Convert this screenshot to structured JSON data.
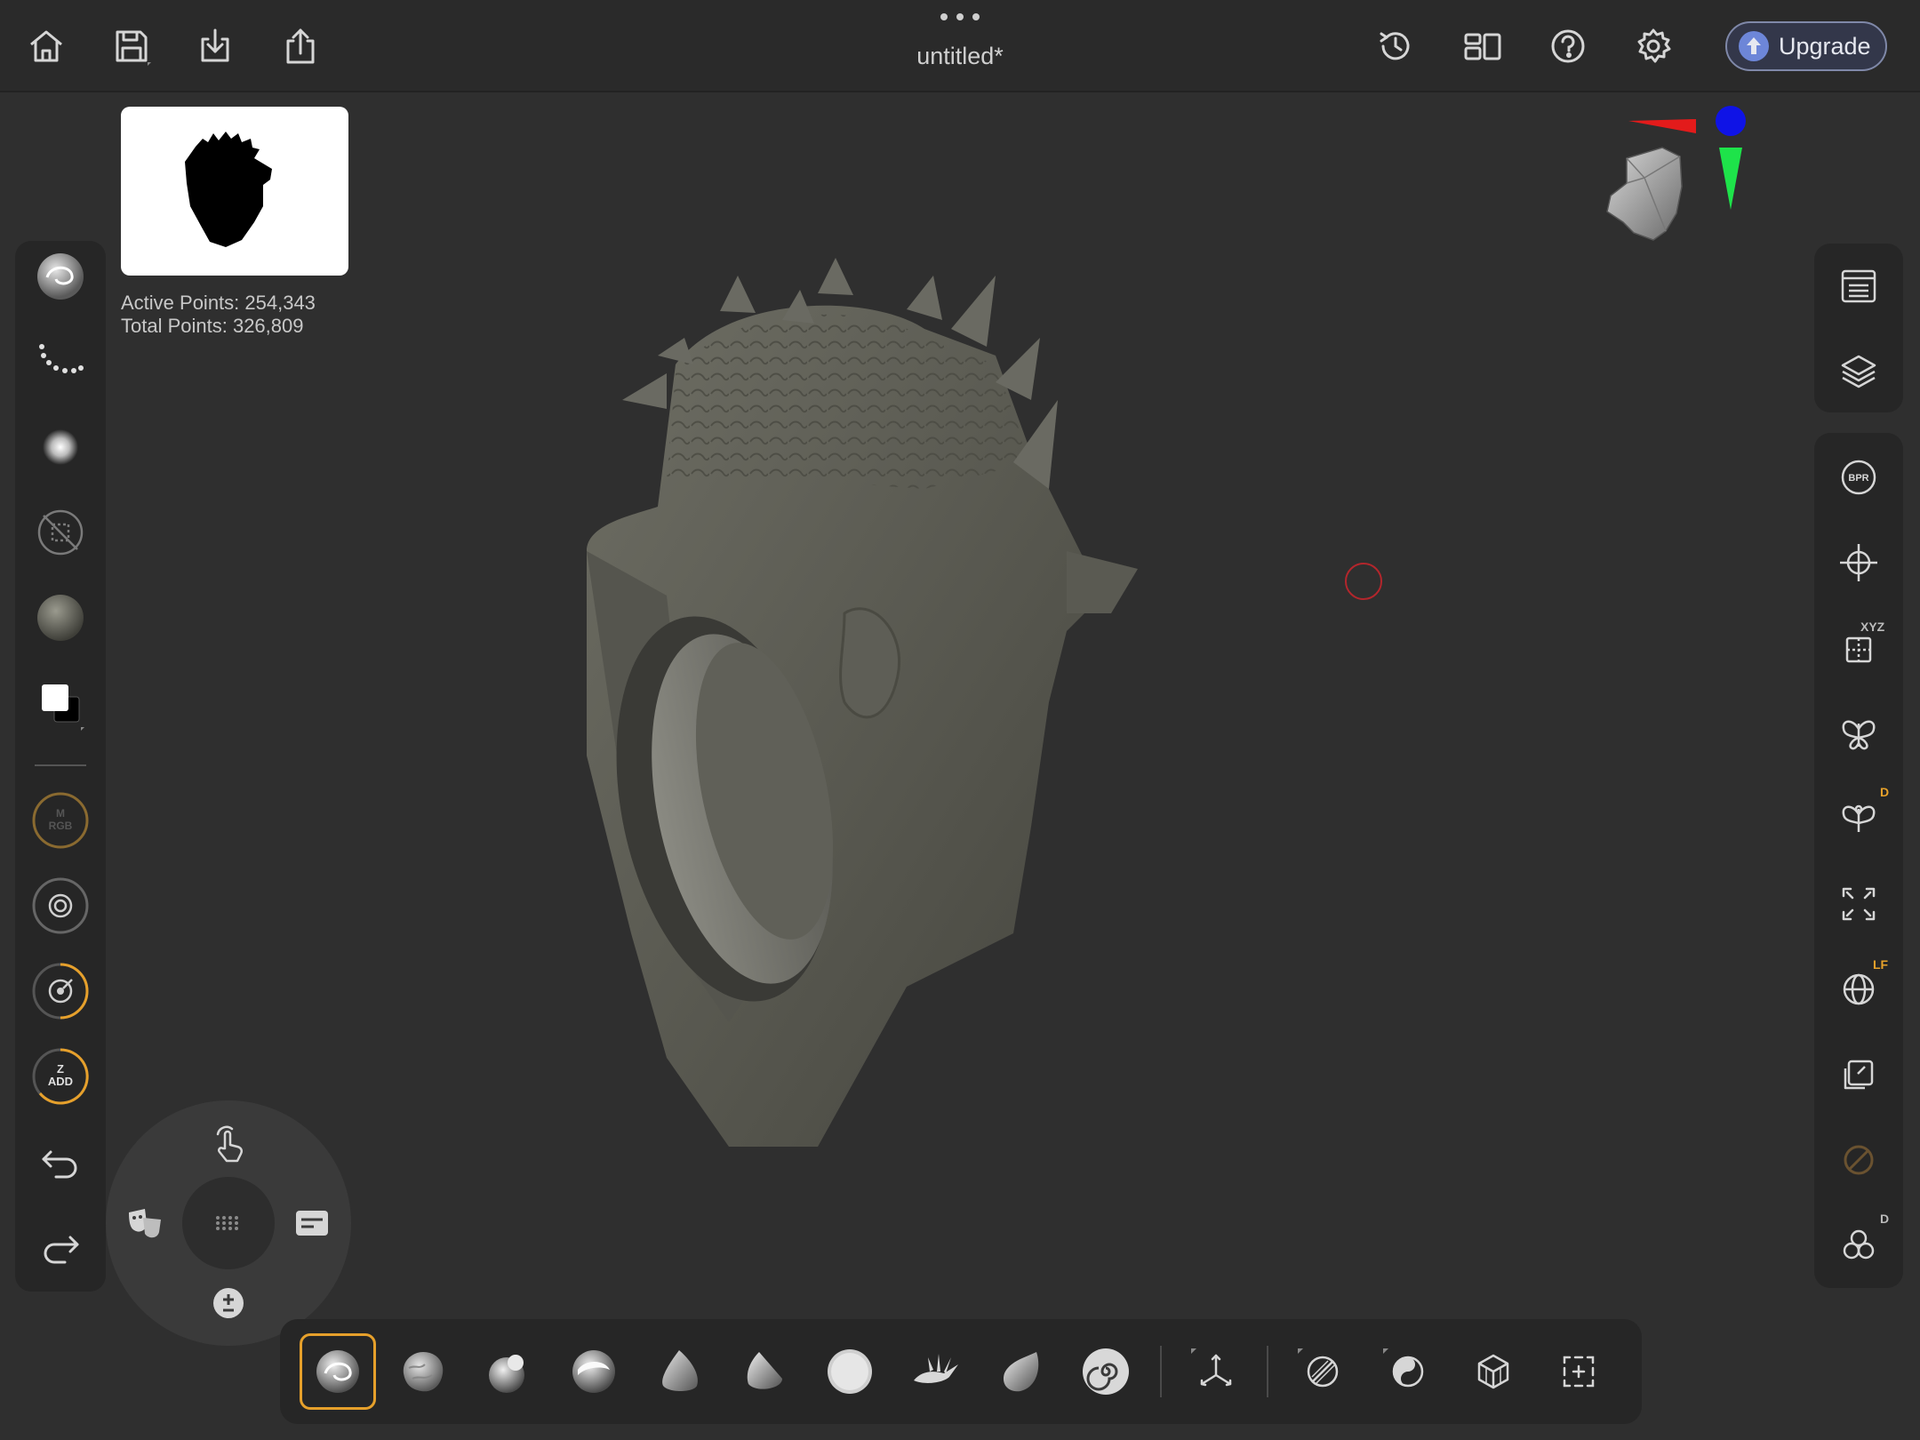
{
  "header": {
    "title": "untitled*",
    "upgrade_label": "Upgrade",
    "icons": [
      "home-icon",
      "save-icon",
      "import-icon",
      "share-icon",
      "history-icon",
      "layout-icon",
      "help-icon",
      "settings-icon"
    ]
  },
  "stats": {
    "active_points": "Active Points: 254,343",
    "total_points": "Total Points: 326,809"
  },
  "left_toolbar": {
    "items": [
      "brush",
      "stroke",
      "alpha",
      "texture-off",
      "material",
      "color",
      "mrgb",
      "focal-shift",
      "draw-size",
      "zadd",
      "undo",
      "redo"
    ],
    "mrgb_label_top": "M",
    "mrgb_label_bottom": "RGB",
    "zadd_label_top": "Z",
    "zadd_label_bottom": "ADD"
  },
  "right_toolbar": {
    "items": [
      "subtool-list",
      "layers",
      "bpr",
      "move-gizmo",
      "xyz-symmetry",
      "mirror",
      "dynamic-symmetry",
      "frame",
      "local-transform",
      "perspective",
      "polyframe-off",
      "dynamesh"
    ],
    "bpr_label": "BPR",
    "xyz_badge": "XYZ",
    "dyn_badge": "D",
    "lf_badge": "LF",
    "dynamesh_badge": "D"
  },
  "brushes": [
    "clay-buildup",
    "clay-tubes",
    "standard",
    "move",
    "trim-dynamic",
    "hpolish",
    "inflate",
    "dam-standard",
    "pinch",
    "snakehook"
  ],
  "tool_icons": [
    "gizmo-icon",
    "mask-icon",
    "polygroup-icon",
    "mesh-icon",
    "selection-icon"
  ],
  "colors": {
    "accent": "#e6a02b",
    "canvas": "#2f2f2f",
    "panel": "#262626"
  }
}
